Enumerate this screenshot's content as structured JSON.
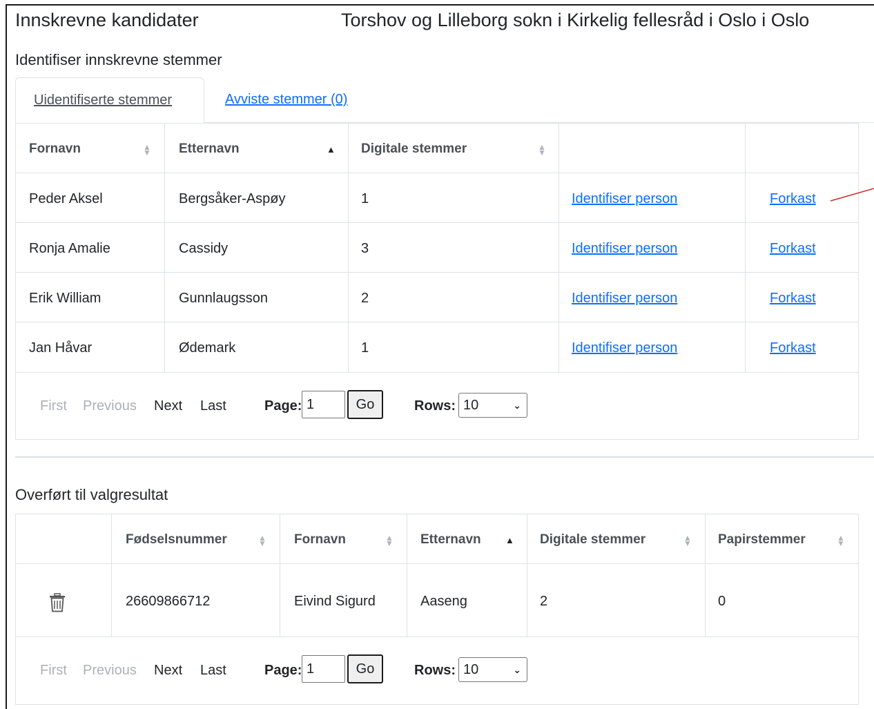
{
  "header": {
    "title": "Innskrevne kandidater",
    "org": "Torshov og Lilleborg sokn i Kirkelig fellesråd i Oslo i Oslo"
  },
  "identify": {
    "section_title": "Identifiser innskrevne stemmer",
    "tabs": [
      {
        "label": "Uidentifiserte stemmer",
        "active": true
      },
      {
        "label": "Avviste stemmer (0)",
        "active": false
      }
    ],
    "columns": [
      "Fornavn",
      "Etternavn",
      "Digitale stemmer"
    ],
    "rows": [
      {
        "fornavn": "Peder Aksel",
        "etternavn": "Bergsåker-Aspøy",
        "digitale": "1",
        "identify": "Identifiser person",
        "discard": "Forkast"
      },
      {
        "fornavn": "Ronja Amalie",
        "etternavn": "Cassidy",
        "digitale": "3",
        "identify": "Identifiser person",
        "discard": "Forkast"
      },
      {
        "fornavn": "Erik William",
        "etternavn": "Gunnlaugsson",
        "digitale": "2",
        "identify": "Identifiser person",
        "discard": "Forkast"
      },
      {
        "fornavn": "Jan Håvar",
        "etternavn": "Ødemark",
        "digitale": "1",
        "identify": "Identifiser person",
        "discard": "Forkast"
      }
    ],
    "pager": {
      "first": "First",
      "previous": "Previous",
      "next": "Next",
      "last": "Last",
      "page_label": "Page:",
      "page_value": "1",
      "go": "Go",
      "rows_label": "Rows:",
      "rows_value": "10"
    }
  },
  "transferred": {
    "section_title": "Overført til valgresultat",
    "columns": [
      "Fødselsnummer",
      "Fornavn",
      "Etternavn",
      "Digitale stemmer",
      "Papirstemmer"
    ],
    "rows": [
      {
        "fodselsnummer": "26609866712",
        "fornavn": "Eivind Sigurd",
        "etternavn": "Aaseng",
        "digitale": "2",
        "papir": "0",
        "delete_icon": "trash-icon"
      }
    ],
    "pager": {
      "first": "First",
      "previous": "Previous",
      "next": "Next",
      "last": "Last",
      "page_label": "Page:",
      "page_value": "1",
      "go": "Go",
      "rows_label": "Rows:",
      "rows_value": "10"
    }
  },
  "colors": {
    "link": "#0d6efd",
    "border": "#dee2e6",
    "disabled": "#aab1b8",
    "annotation": "#d62828"
  }
}
